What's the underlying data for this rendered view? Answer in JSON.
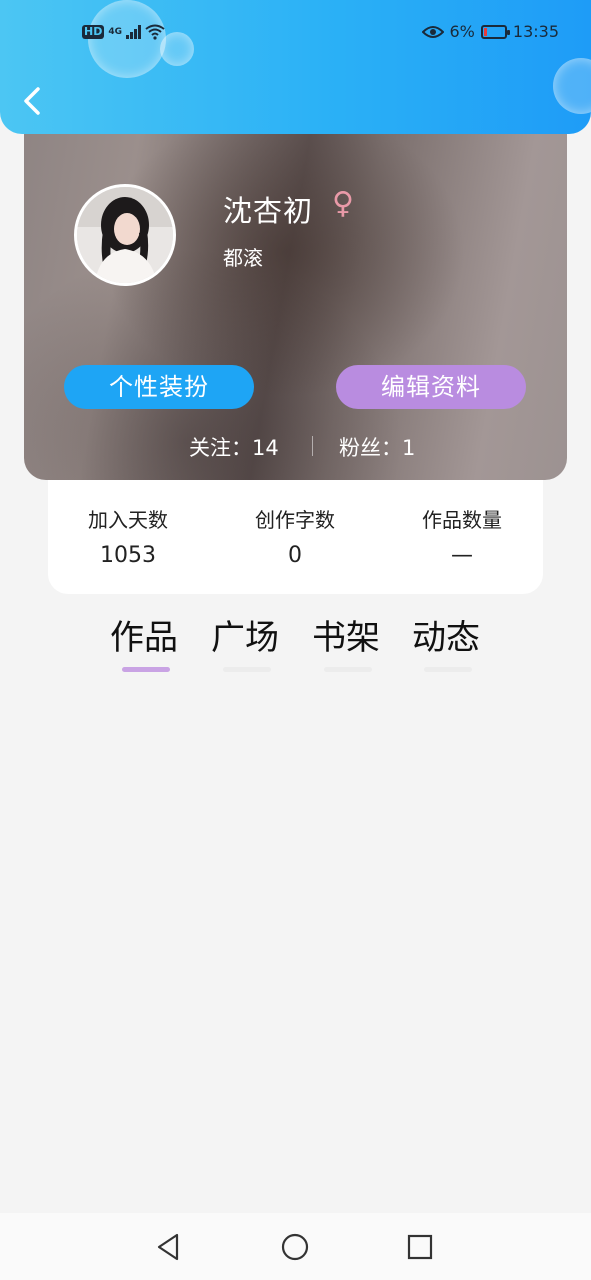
{
  "status_bar": {
    "network_badge": "HD",
    "network_type": "4G",
    "battery": "6%",
    "time": "13:35"
  },
  "header": {
    "back_icon": "chevron-left-icon"
  },
  "profile": {
    "name": "沈杏初",
    "gender_symbol": "♀",
    "subtitle": "都滚",
    "buttons": {
      "dress_up": "个性装扮",
      "edit_profile": "编辑资料"
    },
    "following": "关注：14",
    "followers": "粉丝：1"
  },
  "stats": [
    {
      "label": "加入天数",
      "value": "1053"
    },
    {
      "label": "创作字数",
      "value": "0"
    },
    {
      "label": "作品数量",
      "value": "—"
    }
  ],
  "tabs": [
    {
      "label": "作品",
      "active": true
    },
    {
      "label": "广场",
      "active": false
    },
    {
      "label": "书架",
      "active": false
    },
    {
      "label": "动态",
      "active": false
    }
  ],
  "colors": {
    "header_blue": "#2bb1f6",
    "dress_button": "#1ea5f5",
    "edit_button": "#b98ce0",
    "tab_indicator": "#c9a3e4",
    "gender": "#e99aa8",
    "battery_low": "#e63c3c"
  }
}
